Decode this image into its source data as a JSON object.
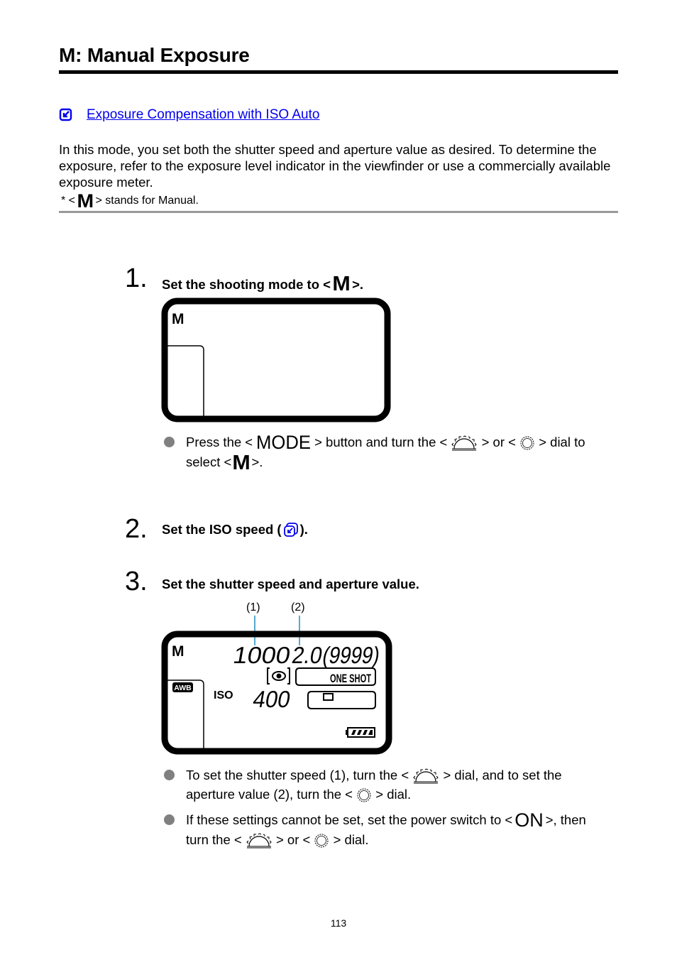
{
  "page": {
    "title": "M: Manual Exposure",
    "page_number": "113"
  },
  "related_link": {
    "icon": "reference-link-icon",
    "label": "Exposure Compensation with ISO Auto"
  },
  "intro": {
    "text": "In this mode, you set both the shutter speed and aperture value as desired. To determine the exposure, refer to the exposure level indicator in the viewfinder or use a commercially available exposure meter.",
    "note_prefix": "* <",
    "note_symbol": "M",
    "note_suffix": "> stands for Manual."
  },
  "steps": [
    {
      "number": "1.",
      "title_prefix": "Set the shooting mode to <",
      "title_symbol": "M",
      "title_suffix": ">.",
      "lcd": {
        "mode": "M"
      },
      "bullets": [
        {
          "parts": [
            "Press the <",
            "MODE",
            "> button and turn the <",
            "main-dial-icon",
            "> or <",
            "quick-control-dial-icon",
            "> dial to select <",
            "M",
            ">."
          ]
        }
      ]
    },
    {
      "number": "2.",
      "title_prefix": "Set the ISO speed (",
      "title_icon": "reference-link-icon",
      "title_suffix": ")."
    },
    {
      "number": "3.",
      "title": "Set the shutter speed and aperture value.",
      "lcd": {
        "mode": "M",
        "callout_1": "(1)",
        "callout_2": "(2)",
        "shutter_speed": "1000",
        "aperture": "2.0",
        "shots_remaining": "(9999)",
        "metering_icon": "evaluative-metering-icon",
        "af_mode": "ONE SHOT",
        "white_balance": "AWB",
        "iso_label": "ISO",
        "iso_value": "400",
        "drive_icon": "single-shooting-icon",
        "battery_icon": "battery-full-icon"
      },
      "bullets": [
        {
          "line1": "To set the shutter speed (1), turn the <",
          "line1b": "> dial, and to set the",
          "line2": "aperture value (2), turn the <",
          "line2b": "> dial."
        },
        {
          "line1": "If these settings cannot be set, set the power switch to <",
          "symbol": "ON",
          "line1b": ">, then",
          "line2": "turn the <",
          "line2b": "> or <",
          "line2c": "> dial."
        }
      ]
    }
  ],
  "colors": {
    "link": "#0000ee",
    "callout_line": "#1a8fc0",
    "bullet": "#808080",
    "rule_gray": "#999999"
  }
}
